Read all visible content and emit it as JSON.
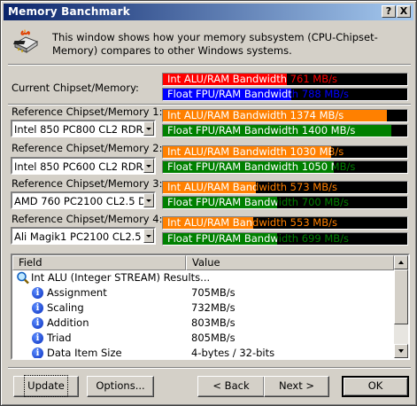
{
  "window": {
    "title": "Memory Banchmark",
    "help_button": "?",
    "close_button": "X"
  },
  "header": {
    "icon": "memory-benchmark-icon",
    "description": "This window shows how your memory subsystem (CPU-Chipset-Memory) compares to other Windows systems."
  },
  "current": {
    "label": "Current Chipset/Memory:",
    "alu": {
      "label": "Int ALU/RAM Bandwidth",
      "value": "761",
      "unit": "MB/s"
    },
    "fpu": {
      "label": "Float FPU/RAM Bandwidth",
      "value": "788",
      "unit": "MB/s"
    }
  },
  "references": [
    {
      "label": "Reference Chipset/Memory 1:",
      "selected": "Intel 850 PC800 CL2 RDRAM (R",
      "alu": {
        "label": "Int ALU/RAM Bandwidth",
        "value": "1374",
        "unit": "MB/s"
      },
      "fpu": {
        "label": "Float FPU/RAM Bandwidth",
        "value": "1400",
        "unit": "MB/s"
      }
    },
    {
      "label": "Reference Chipset/Memory 2:",
      "selected": "Intel 850 PC600 CL2 RDRAM (R",
      "alu": {
        "label": "Int ALU/RAM Bandwidth",
        "value": "1030",
        "unit": "MB/s"
      },
      "fpu": {
        "label": "Float FPU/RAM Bandwidth",
        "value": "1050",
        "unit": "MB/s"
      }
    },
    {
      "label": "Reference Chipset/Memory 3:",
      "selected": "AMD 760 PC2100 CL2.5 DDR (Du",
      "alu": {
        "label": "Int ALU/RAM Bandwidth",
        "value": "573",
        "unit": "MB/s"
      },
      "fpu": {
        "label": "Float FPU/RAM Bandwidth",
        "value": "700",
        "unit": "MB/s"
      }
    },
    {
      "label": "Reference Chipset/Memory 4:",
      "selected": "Ali Magik1 PC2100 CL2.5 DDR",
      "alu": {
        "label": "Int ALU/RAM Bandwidth",
        "value": "553",
        "unit": "MB/s"
      },
      "fpu": {
        "label": "Float FPU/RAM Bandwidth",
        "value": "699",
        "unit": "MB/s"
      }
    }
  ],
  "bar_scale_max_mbs": 1500,
  "colors": {
    "current_alu": "#ff0000",
    "current_fpu": "#0000ff",
    "reference_alu": "#ff8000",
    "reference_fpu": "#008000",
    "bar_background": "#000000"
  },
  "results": {
    "columns": [
      "Field",
      "Value"
    ],
    "rows": [
      {
        "icon": "search-icon",
        "field": "Int ALU (Integer STREAM) Results...",
        "value": "",
        "indent": 0
      },
      {
        "icon": "info-icon",
        "field": "Assignment",
        "value": "705MB/s",
        "indent": 1
      },
      {
        "icon": "info-icon",
        "field": "Scaling",
        "value": "732MB/s",
        "indent": 1
      },
      {
        "icon": "info-icon",
        "field": "Addition",
        "value": "803MB/s",
        "indent": 1
      },
      {
        "icon": "info-icon",
        "field": "Triad",
        "value": "805MB/s",
        "indent": 1
      },
      {
        "icon": "info-icon",
        "field": "Data Item Size",
        "value": "4-bytes / 32-bits",
        "indent": 1
      }
    ]
  },
  "buttons": {
    "update": "Update",
    "options": "Options...",
    "back": "< Back",
    "next": "Next >",
    "ok": "OK"
  }
}
